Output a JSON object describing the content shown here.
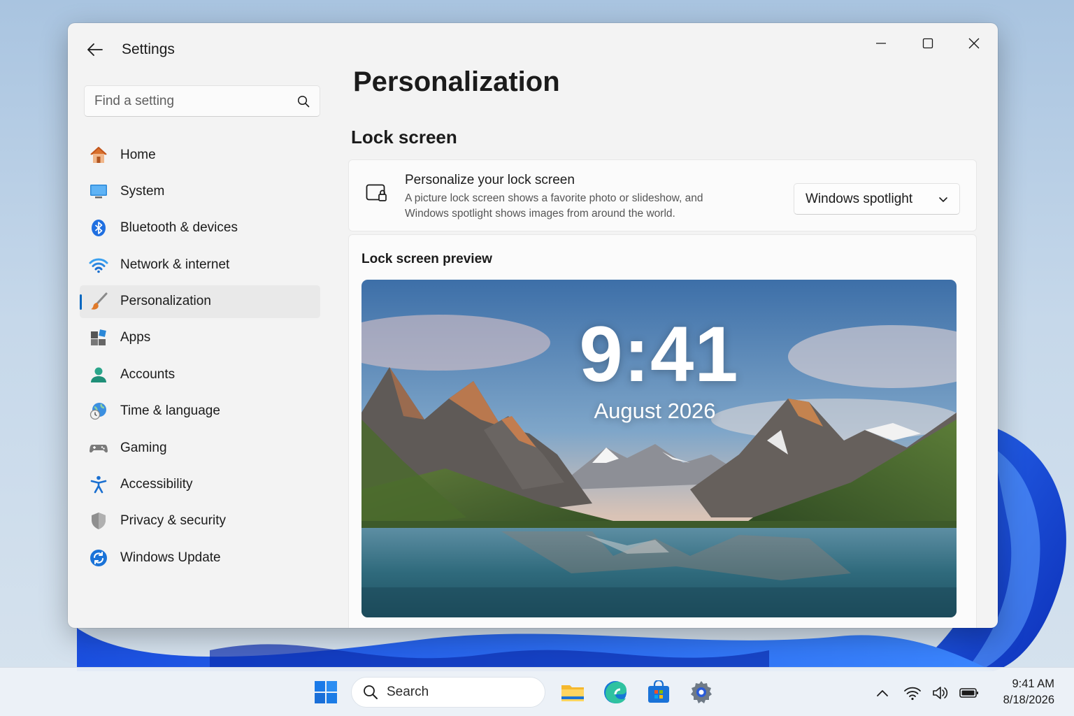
{
  "window": {
    "app_title": "Settings",
    "controls": [
      "minimize-icon",
      "maximize-icon",
      "close-icon"
    ]
  },
  "search": {
    "placeholder": "Find a setting",
    "icon": "search-icon"
  },
  "nav": {
    "items": [
      {
        "label": "Home",
        "icon": "home-icon",
        "selected": false
      },
      {
        "label": "System",
        "icon": "monitor-icon",
        "selected": false
      },
      {
        "label": "Bluetooth & devices",
        "icon": "bluetooth-icon",
        "selected": false
      },
      {
        "label": "Network & internet",
        "icon": "wifi-icon",
        "selected": false
      },
      {
        "label": "Personalization",
        "icon": "brush-icon",
        "selected": true
      },
      {
        "label": "Apps",
        "icon": "apps-icon",
        "selected": false
      },
      {
        "label": "Accounts",
        "icon": "person-icon",
        "selected": false
      },
      {
        "label": "Time & language",
        "icon": "clock-globe-icon",
        "selected": false
      },
      {
        "label": "Gaming",
        "icon": "gamepad-icon",
        "selected": false
      },
      {
        "label": "Accessibility",
        "icon": "accessibility-icon",
        "selected": false
      },
      {
        "label": "Privacy & security",
        "icon": "shield-icon",
        "selected": false
      },
      {
        "label": "Windows Update",
        "icon": "update-icon",
        "selected": false
      }
    ]
  },
  "main": {
    "page_title": "Personalization",
    "section_title": "Lock screen",
    "lock_card": {
      "icon": "lock-screen-icon",
      "title": "Personalize your lock screen",
      "desc_line1": "A picture lock screen shows a favorite photo or slideshow, and",
      "desc_line2": "Windows spotlight shows images from around the world.",
      "dropdown_value": "Windows spotlight"
    },
    "preview": {
      "title": "Lock screen preview",
      "time": "9:41",
      "date": "August 2026"
    }
  },
  "taskbar": {
    "start_icon": "windows-start-icon",
    "search_label": "Search",
    "apps": [
      "file-explorer-icon",
      "edge-icon",
      "store-icon",
      "settings-icon"
    ],
    "tray": [
      "chevron-up-icon",
      "wifi-icon",
      "volume-icon",
      "battery-icon"
    ],
    "time": "9:41 AM",
    "date": "8/18/2026"
  },
  "colors": {
    "accent": "#0067c0",
    "window_bg": "#f3f3f3",
    "card_bg": "#fbfbfb"
  }
}
